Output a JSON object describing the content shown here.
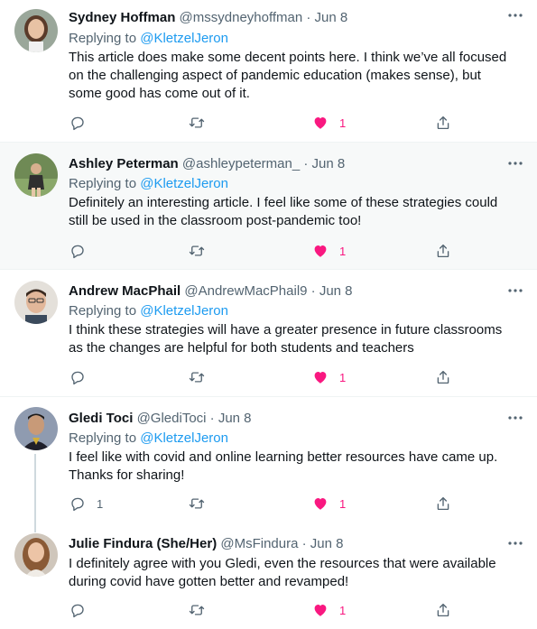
{
  "tweets": [
    {
      "name": "Sydney Hoffman",
      "handle": "@mssydneyhoffman",
      "date": "· Jun 8",
      "replying_label": "Replying to",
      "replying_handle": "@KletzelJeron",
      "lines": [
        "This article does make some decent points here. I think we’ve all focused",
        "on the challenging aspect of pandemic education (makes sense), but",
        "some good has come out of it."
      ],
      "reply_count": "",
      "like_count": "1"
    },
    {
      "name": "Ashley Peterman",
      "handle": "@ashleypeterman_",
      "date": "· Jun 8",
      "replying_label": "Replying to",
      "replying_handle": "@KletzelJeron",
      "lines": [
        "Definitely an interesting article. I feel like some of these strategies could",
        "still be used in the classroom post-pandemic too!"
      ],
      "reply_count": "",
      "like_count": "1"
    },
    {
      "name": "Andrew MacPhail",
      "handle": "@AndrewMacPhail9",
      "date": "· Jun 8",
      "replying_label": "Replying to",
      "replying_handle": "@KletzelJeron",
      "lines": [
        "I think these strategies will have a greater presence in future classrooms",
        "as the changes are helpful for both students and teachers"
      ],
      "reply_count": "",
      "like_count": "1"
    },
    {
      "name": "Gledi Toci",
      "handle": "@GlediToci",
      "date": "· Jun 8",
      "replying_label": "Replying to",
      "replying_handle": "@KletzelJeron",
      "lines": [
        "I feel like with covid and online learning better resources have came up.",
        "Thanks for sharing!"
      ],
      "reply_count": "1",
      "like_count": "1"
    },
    {
      "name": "Julie Findura (She/Her)",
      "handle": "@MsFindura",
      "date": "· Jun 8",
      "lines": [
        "I definitely agree with you Gledi, even the resources that were available",
        "during covid have gotten better and revamped!"
      ],
      "reply_count": "",
      "like_count": "1"
    }
  ],
  "icons": {
    "reply": "reply-icon",
    "retweet": "retweet-icon",
    "like": "heart-icon",
    "share": "share-icon",
    "more": "more-icon"
  },
  "colors": {
    "link": "#1d9bf0",
    "like": "#f91880",
    "secondary": "#536471",
    "highlight_bg": "#f7f9f9"
  }
}
